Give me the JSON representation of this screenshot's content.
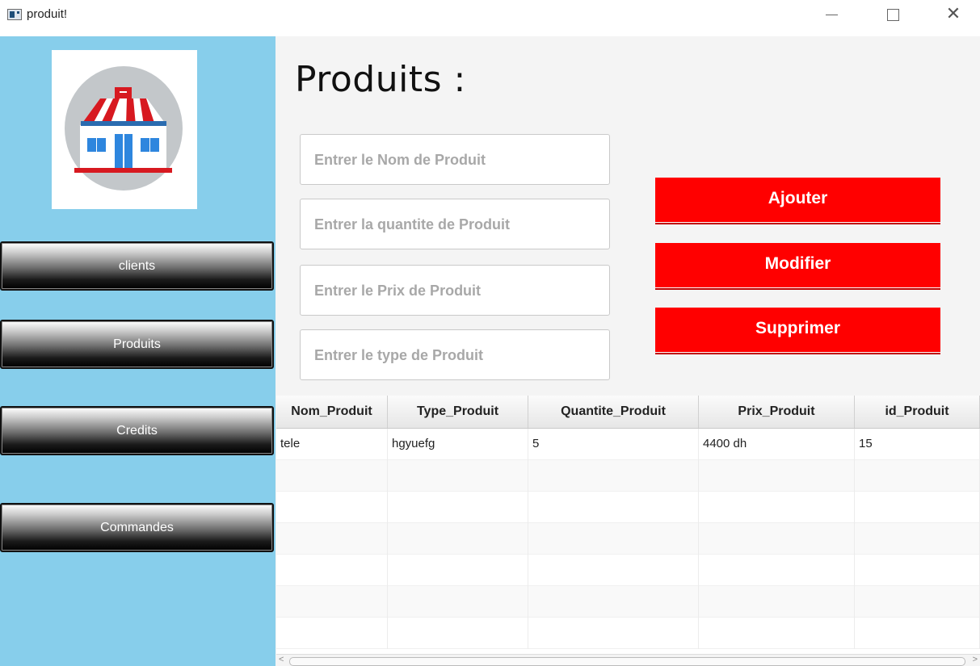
{
  "window": {
    "title": "produit!",
    "minimize": "—",
    "maximize": "☐",
    "close": "✕"
  },
  "sidebar": {
    "logo": "store-logo",
    "buttons": [
      "clients",
      "Produits",
      "Credits",
      "Commandes"
    ]
  },
  "main": {
    "heading": "Produits :",
    "fields": {
      "nom": "Entrer le Nom de Produit",
      "quantite": "Entrer la quantite de Produit",
      "prix": "Entrer le Prix de Produit",
      "type": "Entrer le type de Produit"
    },
    "actions": {
      "add": "Ajouter",
      "edit": "Modifier",
      "delete": "Supprimer"
    },
    "accent_color": "#ff0000",
    "sidebar_color": "#87ceeb"
  },
  "table": {
    "columns": [
      "Nom_Produit",
      "Type_Produit",
      "Quantite_Produit",
      "Prix_Produit",
      "id_Produit"
    ],
    "rows": [
      [
        "tele",
        "hgyuefg",
        "5",
        "4400 dh",
        "15"
      ]
    ]
  }
}
